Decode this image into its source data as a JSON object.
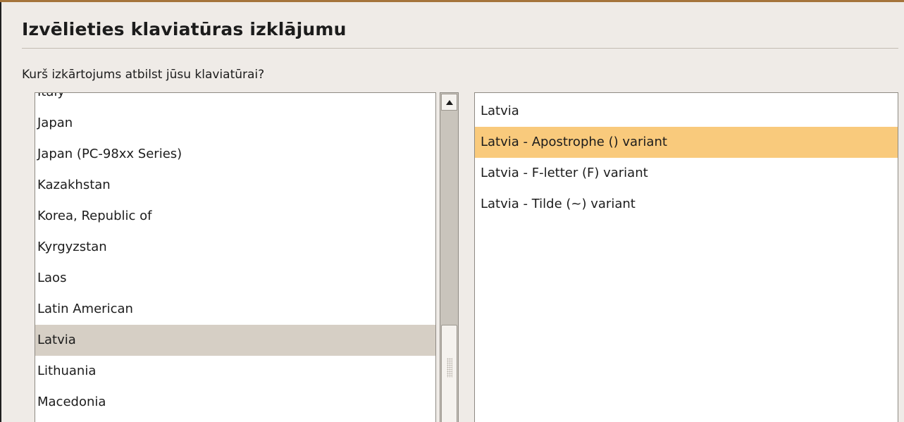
{
  "header": {
    "title": "Izvēlieties klaviatūras izklājumu"
  },
  "main": {
    "question": "Kurš izkārtojums atbilst jūsu klaviatūrai?",
    "countries": [
      {
        "label": "Italy",
        "selected": false
      },
      {
        "label": "Japan",
        "selected": false
      },
      {
        "label": "Japan (PC-98xx Series)",
        "selected": false
      },
      {
        "label": "Kazakhstan",
        "selected": false
      },
      {
        "label": "Korea, Republic of",
        "selected": false
      },
      {
        "label": "Kyrgyzstan",
        "selected": false
      },
      {
        "label": "Laos",
        "selected": false
      },
      {
        "label": "Latin American",
        "selected": false
      },
      {
        "label": "Latvia",
        "selected": true
      },
      {
        "label": "Lithuania",
        "selected": false
      },
      {
        "label": "Macedonia",
        "selected": false
      }
    ],
    "variants": [
      {
        "label": "Latvia",
        "selected": false
      },
      {
        "label": "Latvia - Apostrophe () variant",
        "selected": true
      },
      {
        "label": "Latvia - F-letter (F) variant",
        "selected": false
      },
      {
        "label": "Latvia - Tilde (~) variant",
        "selected": false
      }
    ]
  },
  "colors": {
    "accent_top": "#a5743b",
    "country_selection": "#d6cfc5",
    "variant_selection": "#f9ca7c",
    "window_bg": "#efebe7"
  },
  "icons": {
    "scroll_up": "triangle-up-icon",
    "scroll_grip": "grip-dots-icon"
  }
}
